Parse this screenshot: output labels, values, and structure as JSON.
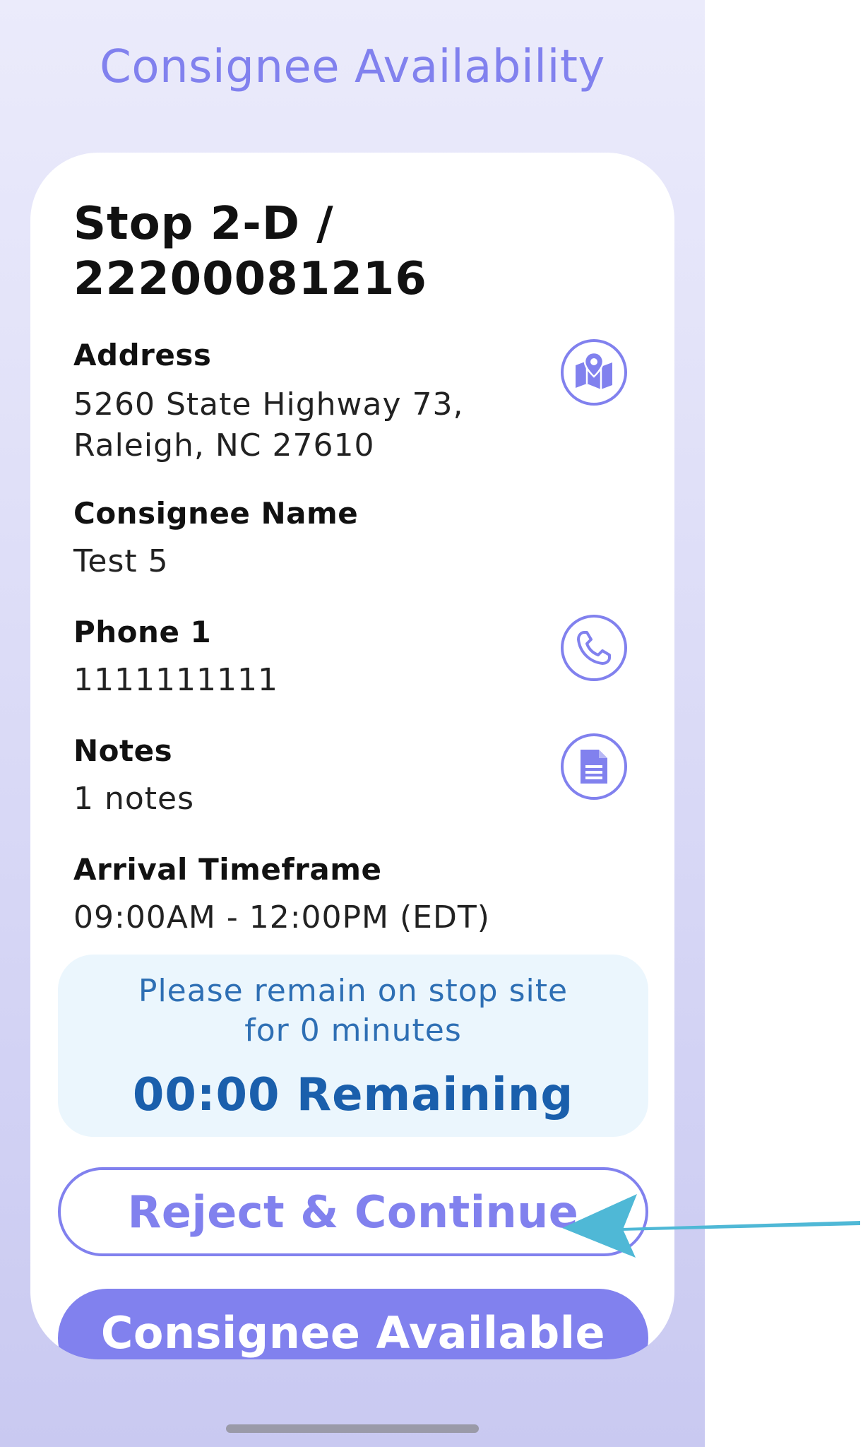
{
  "header": {
    "title": "Consignee Availability"
  },
  "stop": {
    "title_line1": "Stop 2-D /",
    "title_line2": "22200081216"
  },
  "address": {
    "label": "Address",
    "line1": "5260 State Highway 73,",
    "line2": "Raleigh, NC 27610",
    "icon": "map-pin-icon"
  },
  "consignee": {
    "label": "Consignee Name",
    "value": "Test 5"
  },
  "phone": {
    "label": "Phone 1",
    "value": "1111111111",
    "icon": "phone-icon"
  },
  "notes": {
    "label": "Notes",
    "value": "1 notes",
    "icon": "document-icon"
  },
  "arrival": {
    "label": "Arrival Timeframe",
    "value": "09:00AM - 12:00PM (EDT)"
  },
  "timer": {
    "message_line1": "Please remain on stop site",
    "message_line2": "for 0 minutes",
    "countdown": "00:00 Remaining"
  },
  "actions": {
    "reject_label": "Reject & Continue",
    "available_label": "Consignee Available"
  },
  "colors": {
    "accent": "#8181ee",
    "timer_text": "#1a5fac",
    "timer_bg": "#ebf6fd",
    "annotation_arrow": "#4fb8d6"
  }
}
